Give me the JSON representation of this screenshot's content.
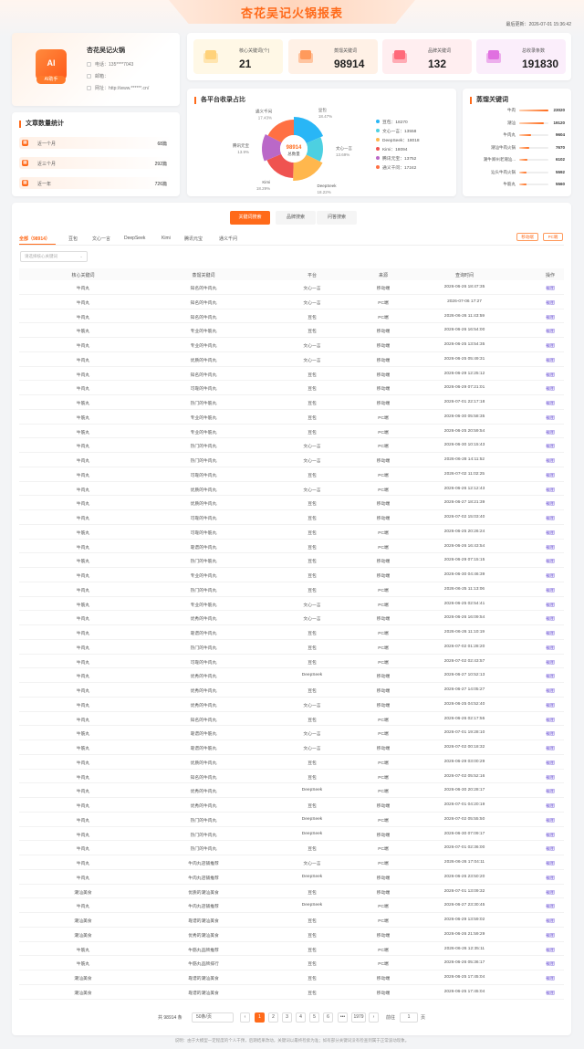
{
  "header": {
    "title": "杏花吴记火锅报表",
    "update_label": "最后更新",
    "update_time": "2026-07-01 15:36:42"
  },
  "profile": {
    "logo_text": "AI",
    "badge": "AI助手",
    "name": "杏花吴记火锅",
    "phone_label": "电话",
    "phone": "135****7043",
    "email_label": "邮箱",
    "email": "",
    "site_label": "网址",
    "site": "http://www.******.cn/"
  },
  "stats": [
    {
      "label": "核心关键词(个)",
      "value": "21",
      "color": "#ffd27a",
      "bg": "#fff8e6"
    },
    {
      "label": "蒸馏关键词",
      "value": "98914",
      "color": "#ff9a5c",
      "bg": "#fff1e6"
    },
    {
      "label": "品牌关键词",
      "value": "132",
      "color": "#ff6a7a",
      "bg": "#ffeef0"
    },
    {
      "label": "总收录条数",
      "value": "191830",
      "color": "#e070e0",
      "bg": "#fbeefb"
    }
  ],
  "articles": {
    "title": "文章数量统计",
    "items": [
      {
        "label": "近一个月",
        "value": "68篇"
      },
      {
        "label": "近三个月",
        "value": "292篇"
      },
      {
        "label": "近一年",
        "value": "726篇"
      }
    ]
  },
  "platform": {
    "title": "各平台收录占比",
    "center_value": "98914",
    "center_label": "总数量",
    "slices": [
      {
        "name": "豆包",
        "value": 18270,
        "pct": "18.47%",
        "color": "#29b6f6"
      },
      {
        "name": "文心一言",
        "value": 13558,
        "pct": "13.69%",
        "color": "#4dd0e1"
      },
      {
        "name": "DeepSeek",
        "value": 18018,
        "pct": "18.22%",
        "color": "#ffb74d"
      },
      {
        "name": "Kimi",
        "value": 18094,
        "pct": "18.29%",
        "color": "#ef5350"
      },
      {
        "name": "腾讯元宝",
        "value": 13752,
        "pct": "13.9%",
        "color": "#ba68c8"
      },
      {
        "name": "通义千问",
        "value": 17242,
        "pct": "17.43%",
        "color": "#ff7043"
      }
    ],
    "legend": [
      "豆包：18270",
      "文心一言：13558",
      "DeepSeek：18018",
      "Kimi：18094",
      "腾讯元宝：13752",
      "通义千问：17242"
    ]
  },
  "keywords": {
    "title": "蒸馏关键词",
    "items": [
      {
        "name": "牛肉",
        "value": "23020",
        "ratio": 1.0
      },
      {
        "name": "潮汕",
        "value": "19120",
        "ratio": 0.83
      },
      {
        "name": "牛肉丸",
        "value": "9604",
        "ratio": 0.42
      },
      {
        "name": "潮汕牛肉火锅",
        "value": "7670",
        "ratio": 0.33
      },
      {
        "name": "潮牛郑州老潮汕...",
        "value": "6102",
        "ratio": 0.27
      },
      {
        "name": "汕头牛肉火锅",
        "value": "5592",
        "ratio": 0.24
      },
      {
        "name": "牛筋丸",
        "value": "5560",
        "ratio": 0.24
      }
    ]
  },
  "main": {
    "tabs": [
      "关键词搜索",
      "品牌搜索",
      "问答搜索"
    ],
    "platform_tabs": [
      "全部（98914）",
      "豆包",
      "文心一言",
      "DeepSeek",
      "Kimi",
      "腾讯元宝",
      "通义千问"
    ],
    "device_buttons": [
      "移动端",
      "PC端"
    ],
    "select_placeholder": "请选择核心关键词",
    "columns": [
      "核心关键词",
      "蒸馏关键词",
      "平台",
      "来源",
      "查询时间",
      "操作"
    ],
    "rows": [
      [
        "牛肉丸",
        "知名的牛肉丸",
        "文心一言",
        "移动端",
        "2026-06-26 18:47:35",
        "截图"
      ],
      [
        "牛肉丸",
        "知名的牛肉丸",
        "文心一言",
        "PC端",
        "2026-07-06 17:27",
        "截图"
      ],
      [
        "牛肉丸",
        "知名的牛肉丸",
        "豆包",
        "PC端",
        "2026-06-26 11:43:59",
        "截图"
      ],
      [
        "牛筋丸",
        "专业的牛筋丸",
        "豆包",
        "移动端",
        "2026-06-26 16:54:00",
        "截图"
      ],
      [
        "牛肉丸",
        "专业的牛肉丸",
        "文心一言",
        "移动端",
        "2026-06-25 13:54:35",
        "截图"
      ],
      [
        "牛肉丸",
        "优质的牛肉丸",
        "文心一言",
        "移动端",
        "2026-06-25 05:49:31",
        "截图"
      ],
      [
        "牛肉丸",
        "知名的牛肉丸",
        "豆包",
        "移动端",
        "2026-06-29 12:25:12",
        "截图"
      ],
      [
        "牛肉丸",
        "可靠的牛肉丸",
        "豆包",
        "移动端",
        "2026-06-29 07:21:01",
        "截图"
      ],
      [
        "牛筋丸",
        "热门的牛筋丸",
        "豆包",
        "移动端",
        "2026-07-01 22:17:18",
        "截图"
      ],
      [
        "牛筋丸",
        "专业的牛筋丸",
        "豆包",
        "PC端",
        "2026-06-30 05:58:35",
        "截图"
      ],
      [
        "牛筋丸",
        "专业的牛筋丸",
        "豆包",
        "PC端",
        "2026-06-25 20:59:54",
        "截图"
      ],
      [
        "牛肉丸",
        "热门的牛肉丸",
        "文心一言",
        "PC端",
        "2026-06-30 10:15:43",
        "截图"
      ],
      [
        "牛肉丸",
        "热门的牛肉丸",
        "文心一言",
        "移动端",
        "2026-06-28 14:11:52",
        "截图"
      ],
      [
        "牛肉丸",
        "可靠的牛肉丸",
        "豆包",
        "PC端",
        "2026-07-02 11:02:25",
        "截图"
      ],
      [
        "牛肉丸",
        "优质的牛肉丸",
        "文心一言",
        "PC端",
        "2026-06-26 12:12:43",
        "截图"
      ],
      [
        "牛肉丸",
        "优质的牛肉丸",
        "豆包",
        "移动端",
        "2026-06-27 18:21:39",
        "截图"
      ],
      [
        "牛肉丸",
        "可靠的牛肉丸",
        "豆包",
        "移动端",
        "2026-07-02 15:03:40",
        "截图"
      ],
      [
        "牛筋丸",
        "可靠的牛筋丸",
        "豆包",
        "PC端",
        "2026-06-25 20:26:24",
        "截图"
      ],
      [
        "牛肉丸",
        "靠谱的牛肉丸",
        "豆包",
        "PC端",
        "2026-06-26 16:43:54",
        "截图"
      ],
      [
        "牛筋丸",
        "热门的牛筋丸",
        "豆包",
        "移动端",
        "2026-06-29 07:15:15",
        "截图"
      ],
      [
        "牛肉丸",
        "专业的牛肉丸",
        "豆包",
        "移动端",
        "2026-06-30 04:46:39",
        "截图"
      ],
      [
        "牛肉丸",
        "热门的牛肉丸",
        "豆包",
        "PC端",
        "2026-06-25 11:13:06",
        "截图"
      ],
      [
        "牛筋丸",
        "专业的牛筋丸",
        "文心一言",
        "PC端",
        "2026-06-25 02:54:41",
        "截图"
      ],
      [
        "牛肉丸",
        "优秀的牛肉丸",
        "文心一言",
        "移动端",
        "2026-06-26 16:09:54",
        "截图"
      ],
      [
        "牛肉丸",
        "靠谱的牛肉丸",
        "豆包",
        "PC端",
        "2026-06-26 11:10:19",
        "截图"
      ],
      [
        "牛肉丸",
        "热门的牛肉丸",
        "豆包",
        "PC端",
        "2026-07-02 01:28:20",
        "截图"
      ],
      [
        "牛肉丸",
        "可靠的牛肉丸",
        "豆包",
        "PC端",
        "2026-07-02 02:43:57",
        "截图"
      ],
      [
        "牛肉丸",
        "优秀的牛肉丸",
        "DeepSeek",
        "移动端",
        "2026-06-27 10:52:13",
        "截图"
      ],
      [
        "牛肉丸",
        "优秀的牛肉丸",
        "豆包",
        "移动端",
        "2026-06-27 14:05:27",
        "截图"
      ],
      [
        "牛肉丸",
        "优秀的牛肉丸",
        "文心一言",
        "移动端",
        "2026-06-25 04:52:40",
        "截图"
      ],
      [
        "牛肉丸",
        "知名的牛肉丸",
        "豆包",
        "PC端",
        "2026-06-26 02:17:55",
        "截图"
      ],
      [
        "牛筋丸",
        "靠谱的牛筋丸",
        "文心一言",
        "PC端",
        "2026-07-01 19:28:10",
        "截图"
      ],
      [
        "牛筋丸",
        "靠谱的牛筋丸",
        "文心一言",
        "移动端",
        "2026-07-02 00:18:32",
        "截图"
      ],
      [
        "牛肉丸",
        "优质的牛肉丸",
        "豆包",
        "PC端",
        "2026-06-29 03:00:29",
        "截图"
      ],
      [
        "牛肉丸",
        "知名的牛肉丸",
        "豆包",
        "PC端",
        "2026-07-02 05:52:16",
        "截图"
      ],
      [
        "牛肉丸",
        "优秀的牛肉丸",
        "DeepSeek",
        "PC端",
        "2026-06-30 20:28:17",
        "截图"
      ],
      [
        "牛肉丸",
        "优秀的牛肉丸",
        "豆包",
        "移动端",
        "2026-07-01 04:20:19",
        "截图"
      ],
      [
        "牛肉丸",
        "热门的牛肉丸",
        "DeepSeek",
        "PC端",
        "2026-07-02 05:55:50",
        "截图"
      ],
      [
        "牛肉丸",
        "热门的牛肉丸",
        "DeepSeek",
        "移动端",
        "2026-06-30 07:09:17",
        "截图"
      ],
      [
        "牛肉丸",
        "热门的牛肉丸",
        "豆包",
        "PC端",
        "2026-07-01 02:36:00",
        "截图"
      ],
      [
        "牛肉丸",
        "牛肉丸店铺推荐",
        "文心一言",
        "PC端",
        "2026-06-26 17:04:11",
        "截图"
      ],
      [
        "牛肉丸",
        "牛肉丸店铺推荐",
        "DeepSeek",
        "移动端",
        "2026-06-26 23:50:20",
        "截图"
      ],
      [
        "潮汕美食",
        "优质的潮汕美食",
        "豆包",
        "移动端",
        "2026-07-01 13:09:32",
        "截图"
      ],
      [
        "牛肉丸",
        "牛肉丸店铺推荐",
        "DeepSeek",
        "PC端",
        "2026-06-27 23:30:45",
        "截图"
      ],
      [
        "潮汕美食",
        "靠谱的潮汕美食",
        "豆包",
        "PC端",
        "2026-06-29 13:59:02",
        "截图"
      ],
      [
        "潮汕美食",
        "优秀的潮汕美食",
        "豆包",
        "移动端",
        "2026-06-26 21:59:29",
        "截图"
      ],
      [
        "牛筋丸",
        "牛筋丸品牌推荐",
        "豆包",
        "PC端",
        "2026-06-26 12:35:11",
        "截图"
      ],
      [
        "牛筋丸",
        "牛筋丸品牌排行",
        "豆包",
        "PC端",
        "2026-06-26 05:36:17",
        "截图"
      ],
      [
        "潮汕美食",
        "靠谱的潮汕美食",
        "豆包",
        "移动端",
        "2026-06-25 17:45:04",
        "截图"
      ],
      [
        "潮汕美食",
        "靠谱的潮汕美食",
        "豆包",
        "移动端",
        "2026-06-25 17:45:04",
        "截图"
      ]
    ],
    "pager": {
      "total": "共 98914 条",
      "page_size": "50条/页",
      "pages": [
        "1",
        "2",
        "3",
        "4",
        "5",
        "6",
        "•••",
        "1979"
      ],
      "prev": "‹",
      "next": "›",
      "goto_label": "前往",
      "goto_value": "1",
      "goto_suffix": "页"
    }
  },
  "footer": "说明：由于大模型一定程度的个人干预，后期结果改动，关键词以最终检索为准；如有部分关键词没有检查到属于正常波动现象。"
}
